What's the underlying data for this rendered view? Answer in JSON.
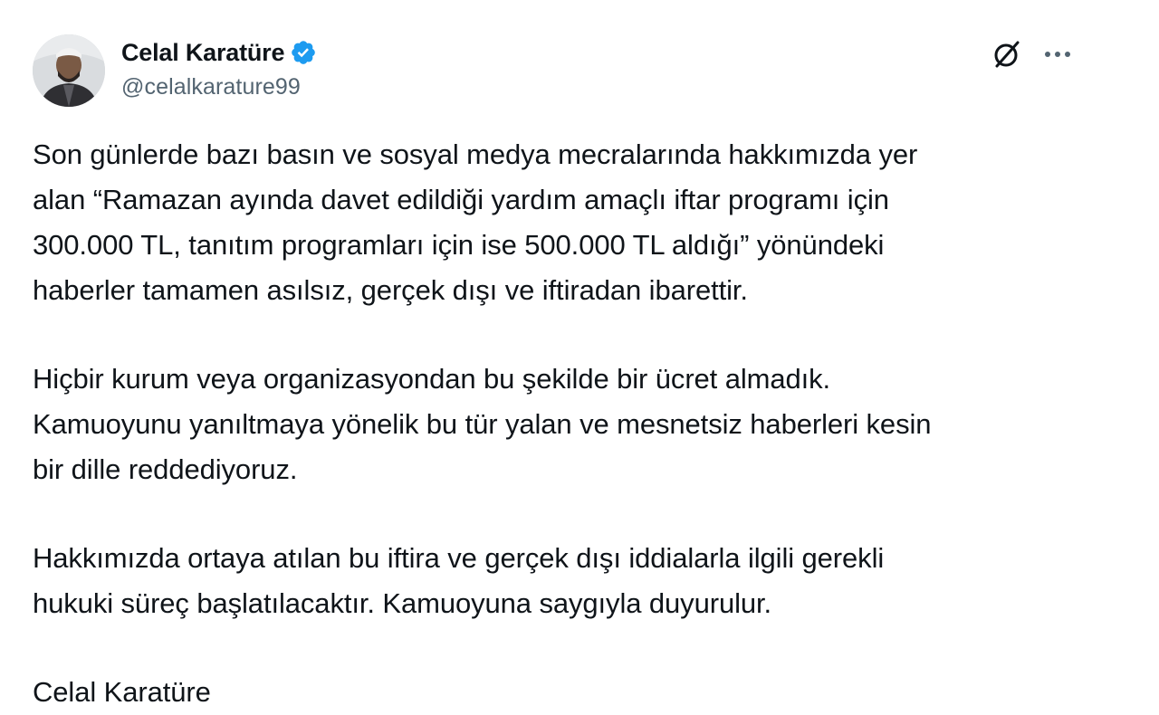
{
  "author": {
    "display_name": "Celal Karatüre",
    "handle": "@celalkarature99",
    "verified": true,
    "verified_color": "#1d9bf0"
  },
  "icons": {
    "grok": "grok-slash-circle-icon",
    "more": "more-horizontal-icon",
    "verified": "verified-badge-icon"
  },
  "tweet": {
    "paragraphs": [
      {
        "lines": [
          "Son günlerde bazı basın ve sosyal medya mecralarında hakkımızda yer",
          "alan “Ramazan ayında davet edildiği yardım amaçlı iftar programı için",
          "300.000 TL, tanıtım programları için ise 500.000 TL aldığı” yönündeki",
          "haberler tamamen asılsız, gerçek dışı ve iftiradan ibarettir."
        ]
      },
      {
        "lines": [
          "Hiçbir kurum veya organizasyondan bu şekilde bir ücret almadık.",
          "Kamuoyunu yanıltmaya yönelik bu tür yalan ve mesnetsiz haberleri kesin",
          "bir dille reddediyoruz."
        ]
      },
      {
        "lines": [
          "Hakkımızda ortaya atılan bu iftira ve gerçek dışı iddialarla ilgili gerekli",
          "hukuki süreç başlatılacaktır. Kamuoyuna saygıyla duyurulur."
        ]
      }
    ],
    "signature": "Celal Karatüre"
  }
}
